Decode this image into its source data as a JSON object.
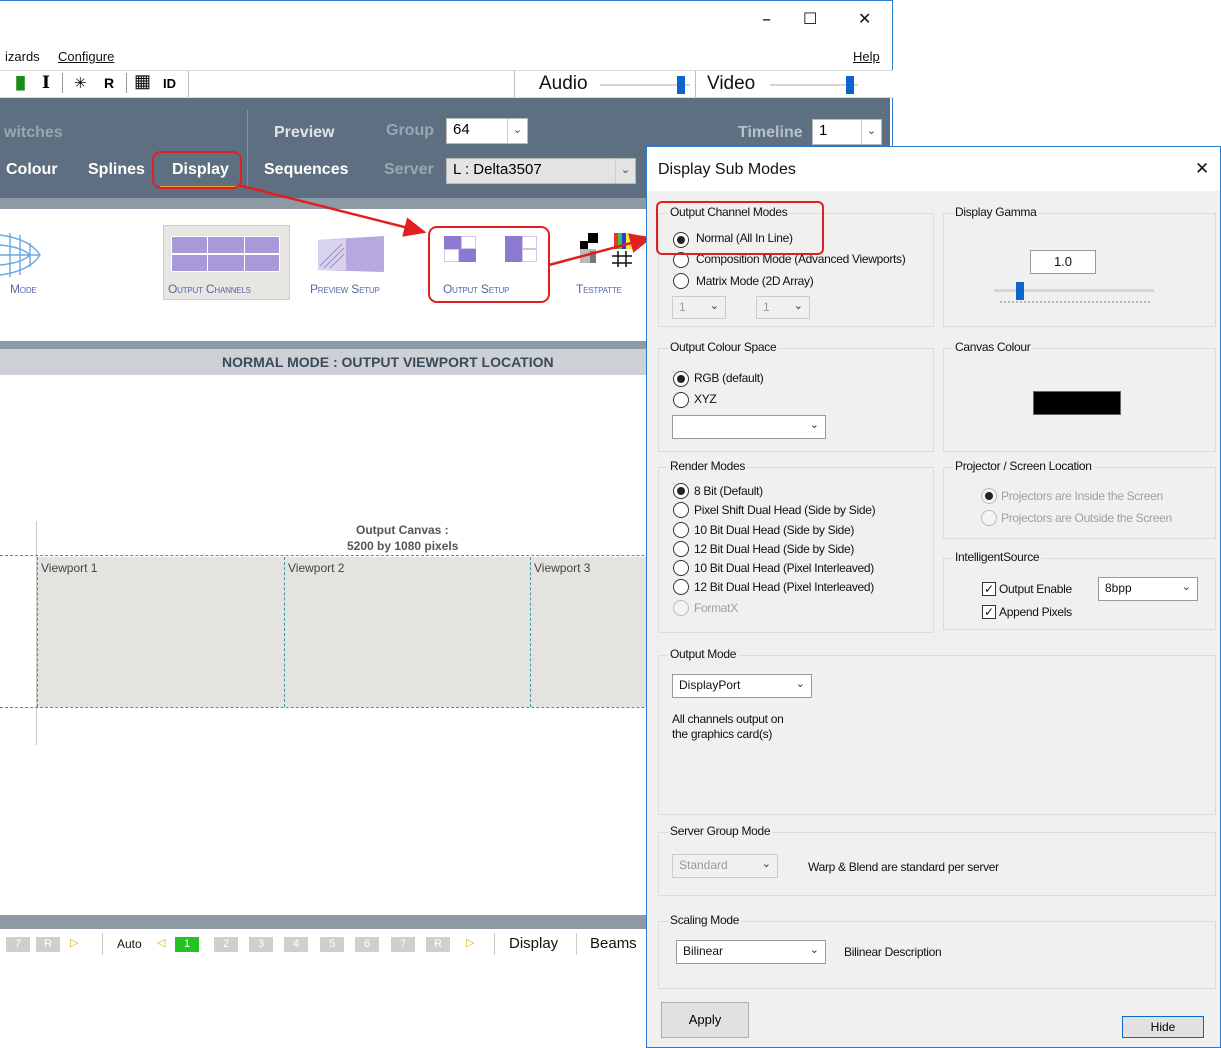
{
  "window": {
    "minimize": "–",
    "maximize": "☐",
    "close": "✕"
  },
  "menu": {
    "wizards": "izards",
    "configure": "Configure",
    "help": "Help"
  },
  "toolbar": {
    "chart_glyph": "▐▌",
    "i_glyph": "I",
    "snow_glyph": "✳",
    "r_glyph": "R",
    "grid_glyph": "▦",
    "id_glyph": "ID",
    "audio_label": "Audio",
    "video_label": "Video"
  },
  "nav": {
    "switches": "witches",
    "preview": "Preview",
    "group_label": "Group",
    "group_value": "64",
    "timeline_label": "Timeline",
    "timeline_value": "1",
    "colour": "Colour",
    "splines": "Splines",
    "display": "Display",
    "sequences": "Sequences",
    "server_label": "Server",
    "server_value": "L : Delta3507"
  },
  "ribbon": {
    "mode": "Mode",
    "output_channels": "Output Channels",
    "preview_setup": "Preview Setup",
    "output_setup": "Output Setup",
    "testpattern": "Testpatte"
  },
  "main": {
    "header": "NORMAL MODE : OUTPUT VIEWPORT LOCATION",
    "canvas_title": "Output Canvas :",
    "canvas_size": "5200 by 1080 pixels",
    "viewports": [
      "Viewport 1",
      "Viewport 2",
      "Viewport 3"
    ]
  },
  "pager": {
    "left": [
      "7",
      "R",
      "▷"
    ],
    "auto": "Auto",
    "prev": "◁",
    "pages": [
      "1",
      "2",
      "3",
      "4",
      "5",
      "6",
      "7",
      "R"
    ],
    "next": "▷",
    "tabs": [
      "Display",
      "Beams"
    ]
  },
  "dialog": {
    "title": "Display Sub Modes",
    "close": "✕",
    "channel_modes": {
      "label": "Output Channel Modes",
      "options": [
        "Normal   (All In Line)",
        "Composition Mode (Advanced Viewports)",
        "Matrix Mode  (2D Array)"
      ],
      "combo1": "1",
      "combo2": "1"
    },
    "gamma": {
      "label": "Display Gamma",
      "value": "1.0"
    },
    "colour_space": {
      "label": "Output Colour Space",
      "options": [
        "RGB (default)",
        "XYZ"
      ]
    },
    "canvas_colour": {
      "label": "Canvas Colour",
      "color": "#000000"
    },
    "render_modes": {
      "label": "Render Modes",
      "options": [
        "8 Bit (Default)",
        "Pixel Shift Dual Head (Side by Side)",
        "10 Bit Dual Head (Side by Side)",
        "12 Bit Dual Head (Side by Side)",
        "10 Bit Dual Head (Pixel Interleaved)",
        "12 Bit Dual Head (Pixel Interleaved)",
        "FormatX"
      ]
    },
    "projector": {
      "label": "Projector / Screen Location",
      "options": [
        "Projectors are Inside the Screen",
        "Projectors are Outside the Screen"
      ]
    },
    "intelligent": {
      "label": "IntelligentSource",
      "output_enable": "Output Enable",
      "bpp": "8bpp",
      "append": "Append Pixels"
    },
    "output_mode": {
      "label": "Output Mode",
      "value": "DisplayPort",
      "desc1": "All channels output on",
      "desc2": "the graphics card(s)"
    },
    "server_group": {
      "label": "Server Group Mode",
      "value": "Standard",
      "desc": "Warp & Blend are standard per server"
    },
    "scaling": {
      "label": "Scaling Mode",
      "value": "Bilinear",
      "desc": "Bilinear Description"
    },
    "apply": "Apply",
    "hide": "Hide"
  }
}
